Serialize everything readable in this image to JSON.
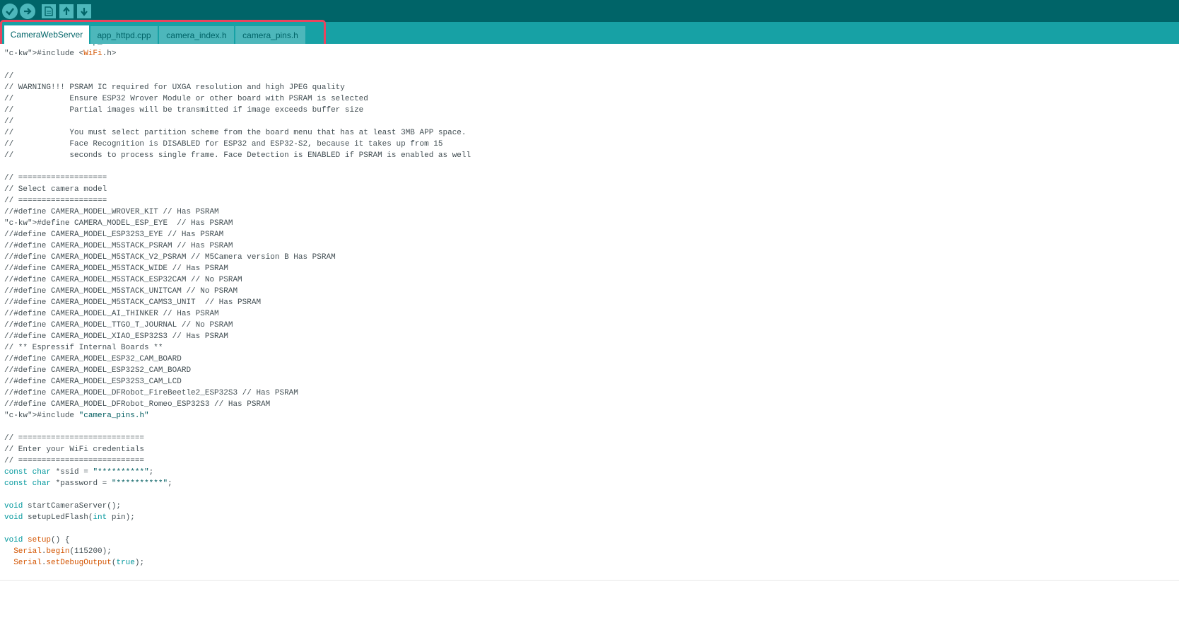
{
  "toolbar": {
    "buttons": [
      {
        "name": "verify-button",
        "icon": "check-icon"
      },
      {
        "name": "upload-button",
        "icon": "arrow-right-icon"
      },
      {
        "name": "new-button",
        "icon": "file-icon"
      },
      {
        "name": "open-button",
        "icon": "arrow-up-icon"
      },
      {
        "name": "save-button",
        "icon": "arrow-down-icon"
      }
    ]
  },
  "tabs": [
    {
      "label": "CameraWebServer",
      "active": true
    },
    {
      "label": "app_httpd.cpp",
      "active": false
    },
    {
      "label": "camera_index.h",
      "active": false
    },
    {
      "label": "camera_pins.h",
      "active": false
    }
  ],
  "colors": {
    "toolbar": "#006468",
    "tabbar": "#17a1a5",
    "tab": "#4db7bb",
    "highlight": "#e9445e"
  },
  "code": [
    "#include \"esp_camera.h\"",
    "#include <WiFi.h>",
    "",
    "//",
    "// WARNING!!! PSRAM IC required for UXGA resolution and high JPEG quality",
    "//            Ensure ESP32 Wrover Module or other board with PSRAM is selected",
    "//            Partial images will be transmitted if image exceeds buffer size",
    "//",
    "//            You must select partition scheme from the board menu that has at least 3MB APP space.",
    "//            Face Recognition is DISABLED for ESP32 and ESP32-S2, because it takes up from 15",
    "//            seconds to process single frame. Face Detection is ENABLED if PSRAM is enabled as well",
    "",
    "// ===================",
    "// Select camera model",
    "// ===================",
    "//#define CAMERA_MODEL_WROVER_KIT // Has PSRAM",
    "#define CAMERA_MODEL_ESP_EYE  // Has PSRAM",
    "//#define CAMERA_MODEL_ESP32S3_EYE // Has PSRAM",
    "//#define CAMERA_MODEL_M5STACK_PSRAM // Has PSRAM",
    "//#define CAMERA_MODEL_M5STACK_V2_PSRAM // M5Camera version B Has PSRAM",
    "//#define CAMERA_MODEL_M5STACK_WIDE // Has PSRAM",
    "//#define CAMERA_MODEL_M5STACK_ESP32CAM // No PSRAM",
    "//#define CAMERA_MODEL_M5STACK_UNITCAM // No PSRAM",
    "//#define CAMERA_MODEL_M5STACK_CAMS3_UNIT  // Has PSRAM",
    "//#define CAMERA_MODEL_AI_THINKER // Has PSRAM",
    "//#define CAMERA_MODEL_TTGO_T_JOURNAL // No PSRAM",
    "//#define CAMERA_MODEL_XIAO_ESP32S3 // Has PSRAM",
    "// ** Espressif Internal Boards **",
    "//#define CAMERA_MODEL_ESP32_CAM_BOARD",
    "//#define CAMERA_MODEL_ESP32S2_CAM_BOARD",
    "//#define CAMERA_MODEL_ESP32S3_CAM_LCD",
    "//#define CAMERA_MODEL_DFRobot_FireBeetle2_ESP32S3 // Has PSRAM",
    "//#define CAMERA_MODEL_DFRobot_Romeo_ESP32S3 // Has PSRAM",
    "#include \"camera_pins.h\"",
    "",
    "// ===========================",
    "// Enter your WiFi credentials",
    "// ===========================",
    "const char *ssid = \"**********\";",
    "const char *password = \"**********\";",
    "",
    "void startCameraServer();",
    "void setupLedFlash(int pin);",
    "",
    "void setup() {",
    "  Serial.begin(115200);",
    "  Serial.setDebugOutput(true);"
  ]
}
